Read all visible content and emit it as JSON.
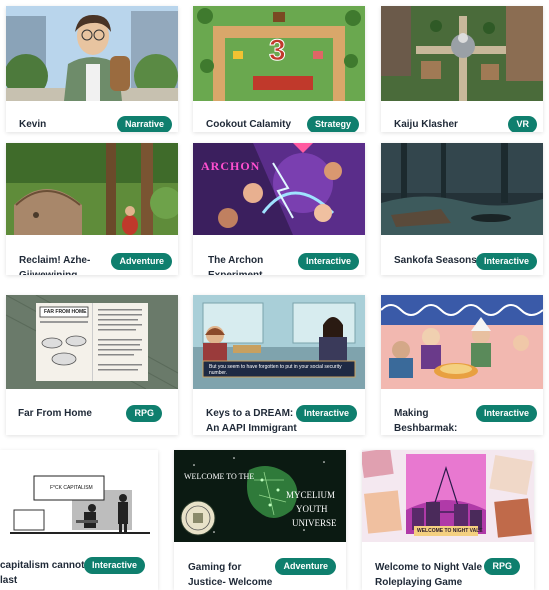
{
  "games": [
    {
      "title": "Kevin",
      "genre": "Narrative"
    },
    {
      "title": "Cookout Calamity",
      "genre": "Strategy",
      "thumb_number": "3"
    },
    {
      "title": "Kaiju Klasher",
      "genre": "VR"
    },
    {
      "title": "Reclaim! Azhe-\nGiiwewining",
      "genre": "Adventure"
    },
    {
      "title": "The Archon\nExperiment",
      "genre": "Interactive",
      "thumb_logo": "ARCHON"
    },
    {
      "title": "Sankofa Seasons",
      "genre": "Interactive"
    },
    {
      "title": "Far From Home",
      "genre": "RPG",
      "thumb_heading": "FAR FROM HOME"
    },
    {
      "title": "Keys to a DREAM:\nAn AAPI Immigrant",
      "genre": "Interactive",
      "thumb_dialog": "But you seem to have forgotten to put in your social security number."
    },
    {
      "title": "Making\nBeshbarmak:",
      "genre": "Interactive"
    },
    {
      "title": "capitalism cannot\nlast",
      "genre": "Interactive",
      "thumb_sign": "F*CK CAPITALISM"
    },
    {
      "title": "Gaming for\nJustice- Welcome",
      "genre": "Adventure",
      "thumb_welcome": "WELCOME TO THE",
      "thumb_logo_lines": [
        "MYCELIUM",
        "YOUTH",
        "UNIVERSE"
      ]
    },
    {
      "title": "Welcome to Night Vale\nRoleplaying Game",
      "genre": "RPG",
      "thumb_banner": "WELCOME TO NIGHT VALE"
    }
  ],
  "colors": {
    "badge": "#0f7f6e",
    "title": "#1f2937"
  }
}
